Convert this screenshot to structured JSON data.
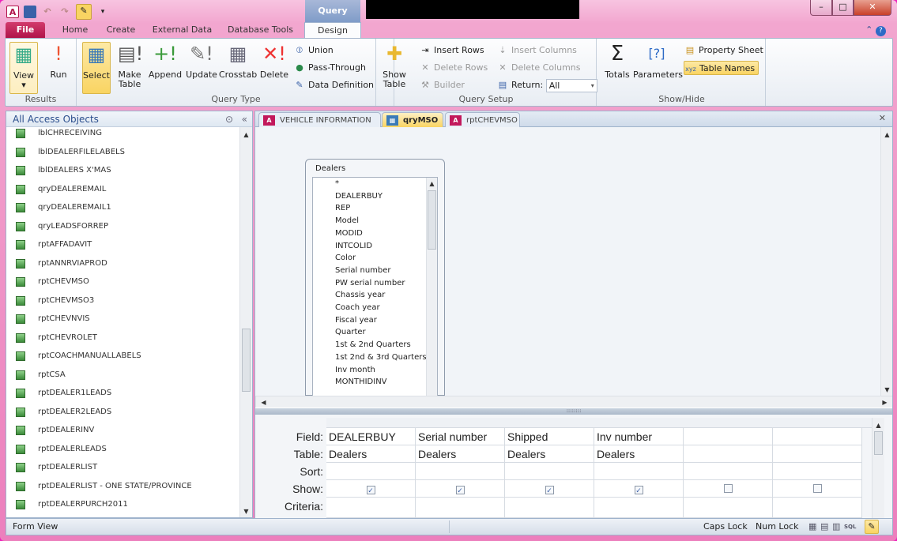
{
  "titlebar": {
    "context_tab": "Query Tools",
    "app_icon": "A",
    "minimize": "–",
    "maximize": "□",
    "close": "✕"
  },
  "ribbon_tabs": [
    "File",
    "Home",
    "Create",
    "External Data",
    "Database Tools",
    "Design"
  ],
  "ribbon": {
    "results": {
      "label": "Results",
      "view": "View",
      "run": "Run"
    },
    "query_type": {
      "label": "Query Type",
      "select": "Select",
      "make_table": "Make Table",
      "append": "Append",
      "update": "Update",
      "crosstab": "Crosstab",
      "delete": "Delete",
      "union": "Union",
      "pass_through": "Pass-Through",
      "data_definition": "Data Definition"
    },
    "query_setup": {
      "label": "Query Setup",
      "show_table": "Show Table",
      "insert_rows": "Insert Rows",
      "delete_rows": "Delete Rows",
      "builder": "Builder",
      "insert_columns": "Insert Columns",
      "delete_columns": "Delete Columns",
      "return_label": "Return:",
      "return_value": "All"
    },
    "show_hide": {
      "label": "Show/Hide",
      "totals": "Totals",
      "parameters": "Parameters",
      "property_sheet": "Property Sheet",
      "table_names": "Table Names"
    }
  },
  "nav": {
    "title": "All Access Objects",
    "items": [
      "lblCHRECEIVING",
      "lblDEALERFILELABELS",
      "lblDEALERS X'MAS",
      "qryDEALEREMAIL",
      "qryDEALEREMAIL1",
      "qryLEADSFORREP",
      "rptAFFADAVIT",
      "rptANNRVIAPROD",
      "rptCHEVMSO",
      "rptCHEVMSO3",
      "rptCHEVNVIS",
      "rptCHEVROLET",
      "rptCOACHMANUALLABELS",
      "rptCSA",
      "rptDEALER1LEADS",
      "rptDEALER2LEADS",
      "rptDEALERINV",
      "rptDEALERLEADS",
      "rptDEALERLIST",
      "rptDEALERLIST - ONE STATE/PROVINCE",
      "rptDEALERPURCH2011"
    ]
  },
  "doc_tabs": [
    "VEHICLE INFORMATION",
    "qryMSO",
    "rptCHEVMSO"
  ],
  "table": {
    "name": "Dealers",
    "fields": [
      "*",
      "DEALERBUY",
      "REP",
      "Model",
      "MODID",
      "INTCOLID",
      "Color",
      "Serial number",
      "PW serial number",
      "Chassis year",
      "Coach year",
      "Fiscal year",
      "Quarter",
      "1st & 2nd Quarters",
      "1st 2nd & 3rd Quarters",
      "Inv month",
      "MONTHIDINV"
    ]
  },
  "grid": {
    "row_labels": [
      "Field:",
      "Table:",
      "Sort:",
      "Show:",
      "Criteria:"
    ],
    "columns": [
      {
        "field": "DEALERBUY",
        "table": "Dealers",
        "show": true
      },
      {
        "field": "Serial number",
        "table": "Dealers",
        "show": true
      },
      {
        "field": "Shipped",
        "table": "Dealers",
        "show": true
      },
      {
        "field": "Inv number",
        "table": "Dealers",
        "show": true
      },
      {
        "field": "",
        "table": "",
        "show": false
      },
      {
        "field": "",
        "table": "",
        "show": false
      }
    ]
  },
  "status": {
    "left": "Form View",
    "caps": "Caps Lock",
    "num": "Num Lock",
    "sql": "SQL"
  }
}
